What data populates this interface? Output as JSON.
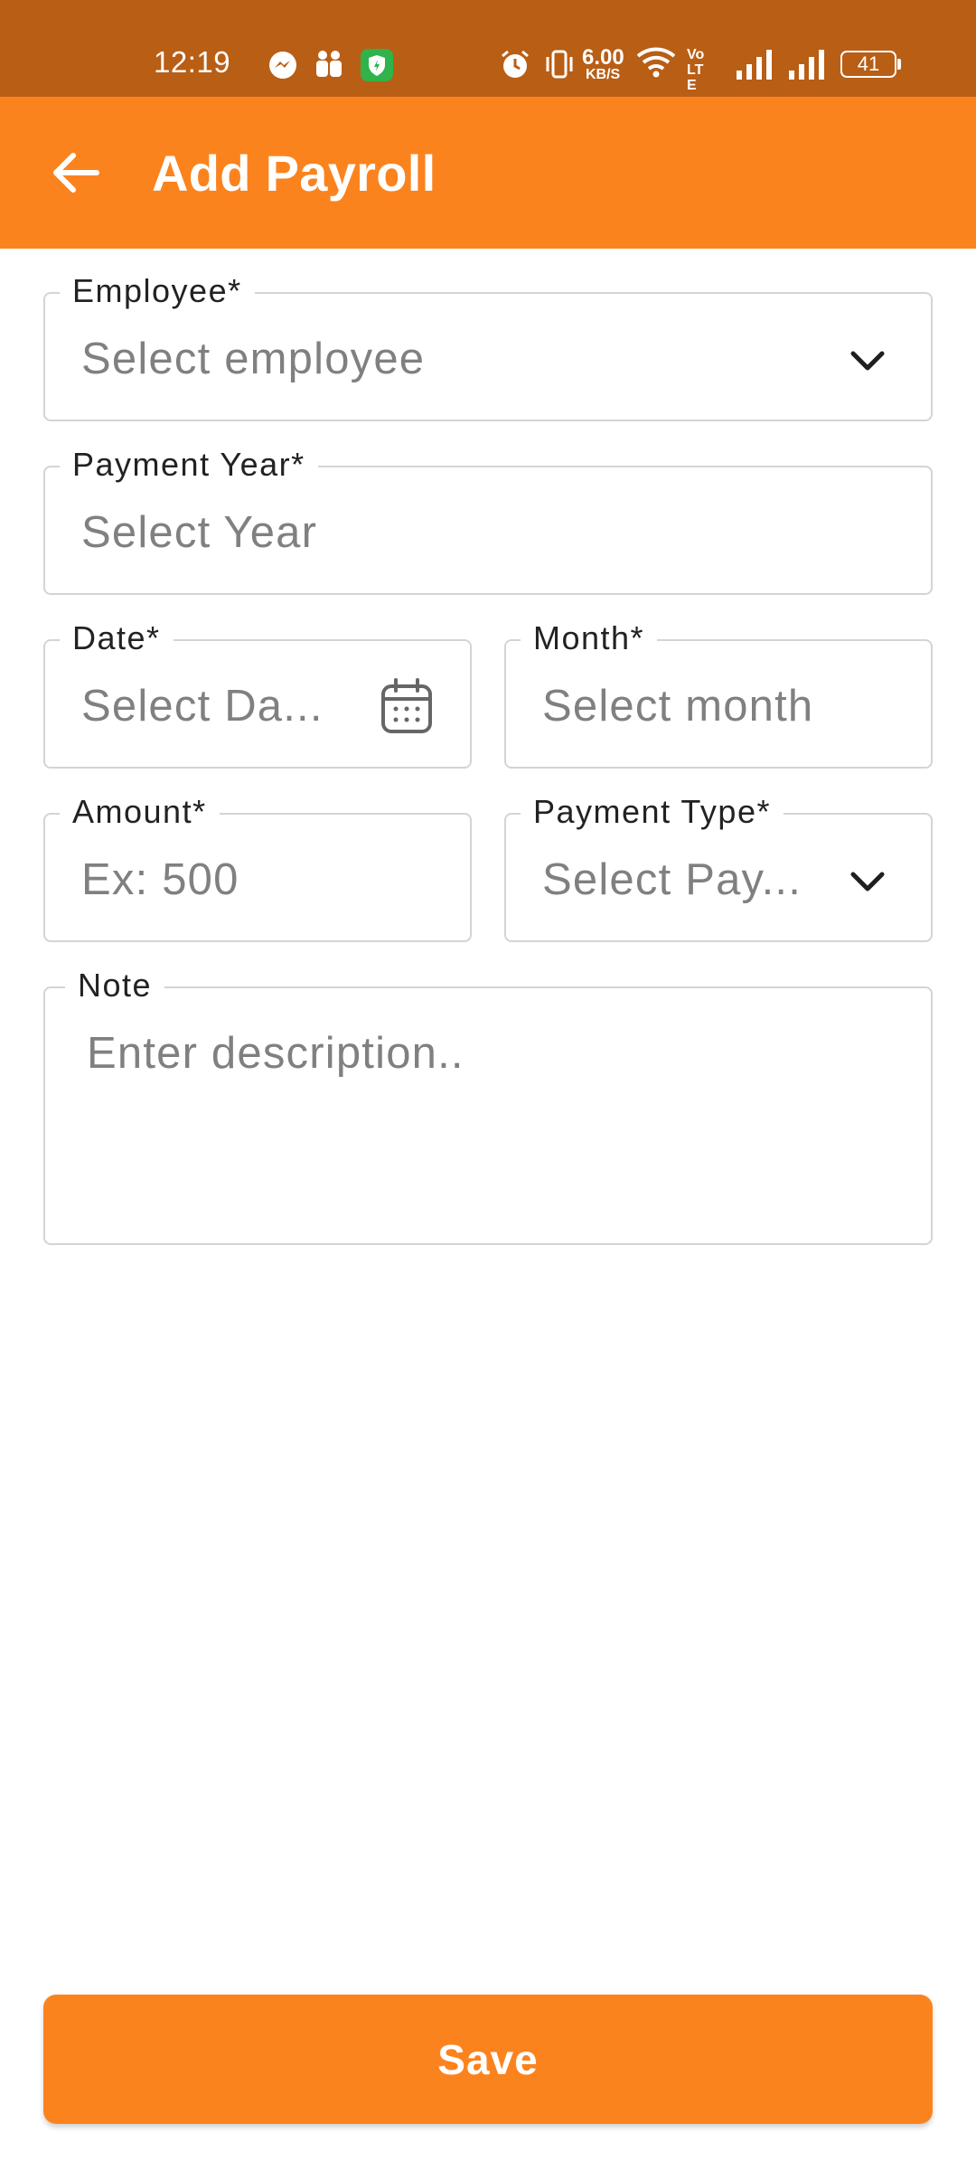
{
  "status_bar": {
    "time": "12:19",
    "net_speed_value": "6.00",
    "net_speed_unit": "KB/S",
    "volte": "Vo LTE",
    "battery": "41"
  },
  "app_bar": {
    "title": "Add Payroll"
  },
  "form": {
    "employee": {
      "label": "Employee*",
      "placeholder": "Select employee"
    },
    "payment_year": {
      "label": "Payment Year*",
      "placeholder": "Select Year"
    },
    "date": {
      "label": "Date*",
      "placeholder": "Select Da..."
    },
    "month": {
      "label": "Month*",
      "placeholder": "Select month"
    },
    "amount": {
      "label": "Amount*",
      "placeholder": "Ex: 500"
    },
    "payment_type": {
      "label": "Payment Type*",
      "placeholder": "Select Pay..."
    },
    "note": {
      "label": "Note",
      "placeholder": "Enter description.."
    }
  },
  "save_label": "Save",
  "colors": {
    "status_bar": "#B95E15",
    "accent": "#FB831E",
    "field_border": "#D4D4D4",
    "placeholder": "#808080"
  },
  "icons": {
    "back": "arrow-left-icon",
    "dropdown": "chevron-down-icon",
    "date": "calendar-icon"
  }
}
